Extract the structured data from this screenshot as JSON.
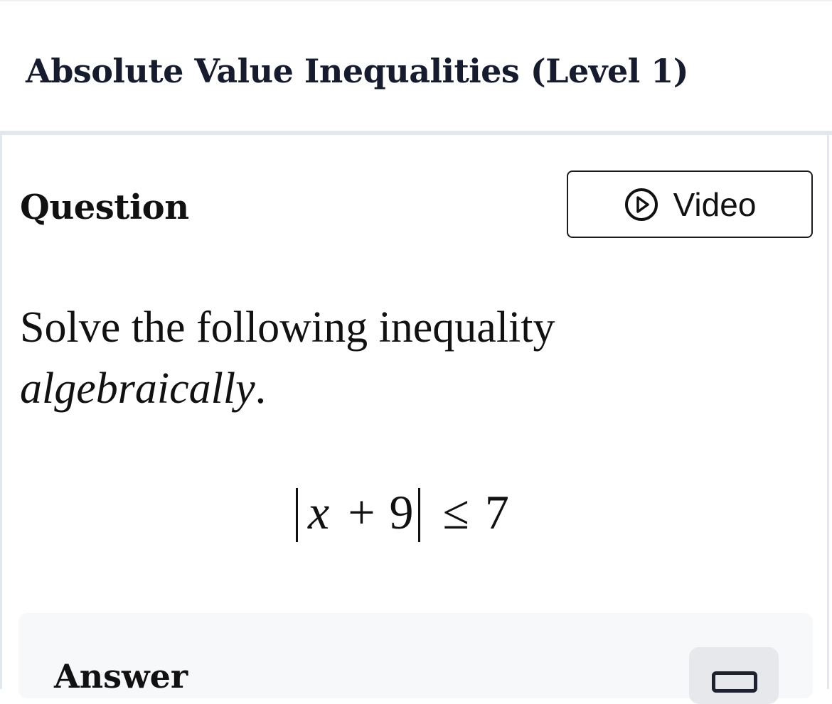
{
  "header": {
    "title": "Absolute Value Inequalities (Level 1)"
  },
  "question": {
    "heading": "Question",
    "video_button": {
      "label": "Video",
      "icon": "play-circle-icon"
    },
    "prompt_regular": "Solve the following inequality",
    "prompt_emphasis": "algebraically",
    "prompt_end": ".",
    "expression": {
      "variable": "x",
      "plus": "+",
      "constant": "9",
      "relation": "≤",
      "bound": "7"
    }
  },
  "answer": {
    "heading": "Answer",
    "keypad_icon": "keyboard-icon"
  }
}
